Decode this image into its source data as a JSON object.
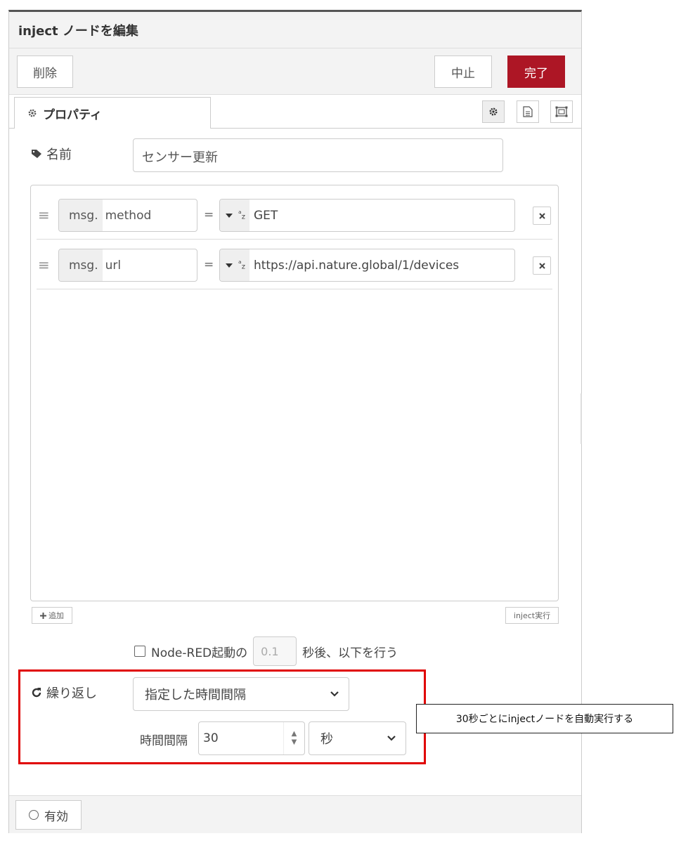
{
  "window": {
    "title": "inject ノードを編集"
  },
  "toolbar": {
    "delete_label": "削除",
    "cancel_label": "中止",
    "done_label": "完了"
  },
  "tabs": {
    "properties_label": "プロパティ"
  },
  "name": {
    "label": "名前",
    "value": "センサー更新"
  },
  "props": [
    {
      "prefix": "msg.",
      "key": "method",
      "value_type": "az",
      "value": "GET"
    },
    {
      "prefix": "msg.",
      "key": "url",
      "value_type": "az",
      "value": "https://api.nature.global/1/devices"
    }
  ],
  "buttons": {
    "add_label": "追加",
    "inject_now_label": "inject実行"
  },
  "once": {
    "label": "Node-RED起動の",
    "delay_value": "0.1",
    "suffix": "秒後、以下を行う"
  },
  "repeat": {
    "label": "繰り返し",
    "mode_selected": "指定した時間間隔",
    "interval_label": "時間間隔",
    "interval_value": "30",
    "unit_selected": "秒"
  },
  "annotation": {
    "text": "30秒ごとにinjectノードを自動実行する"
  },
  "footer": {
    "enable_label": "有効"
  },
  "colors": {
    "done_button": "#ad1625",
    "highlight_border": "#e00000"
  }
}
